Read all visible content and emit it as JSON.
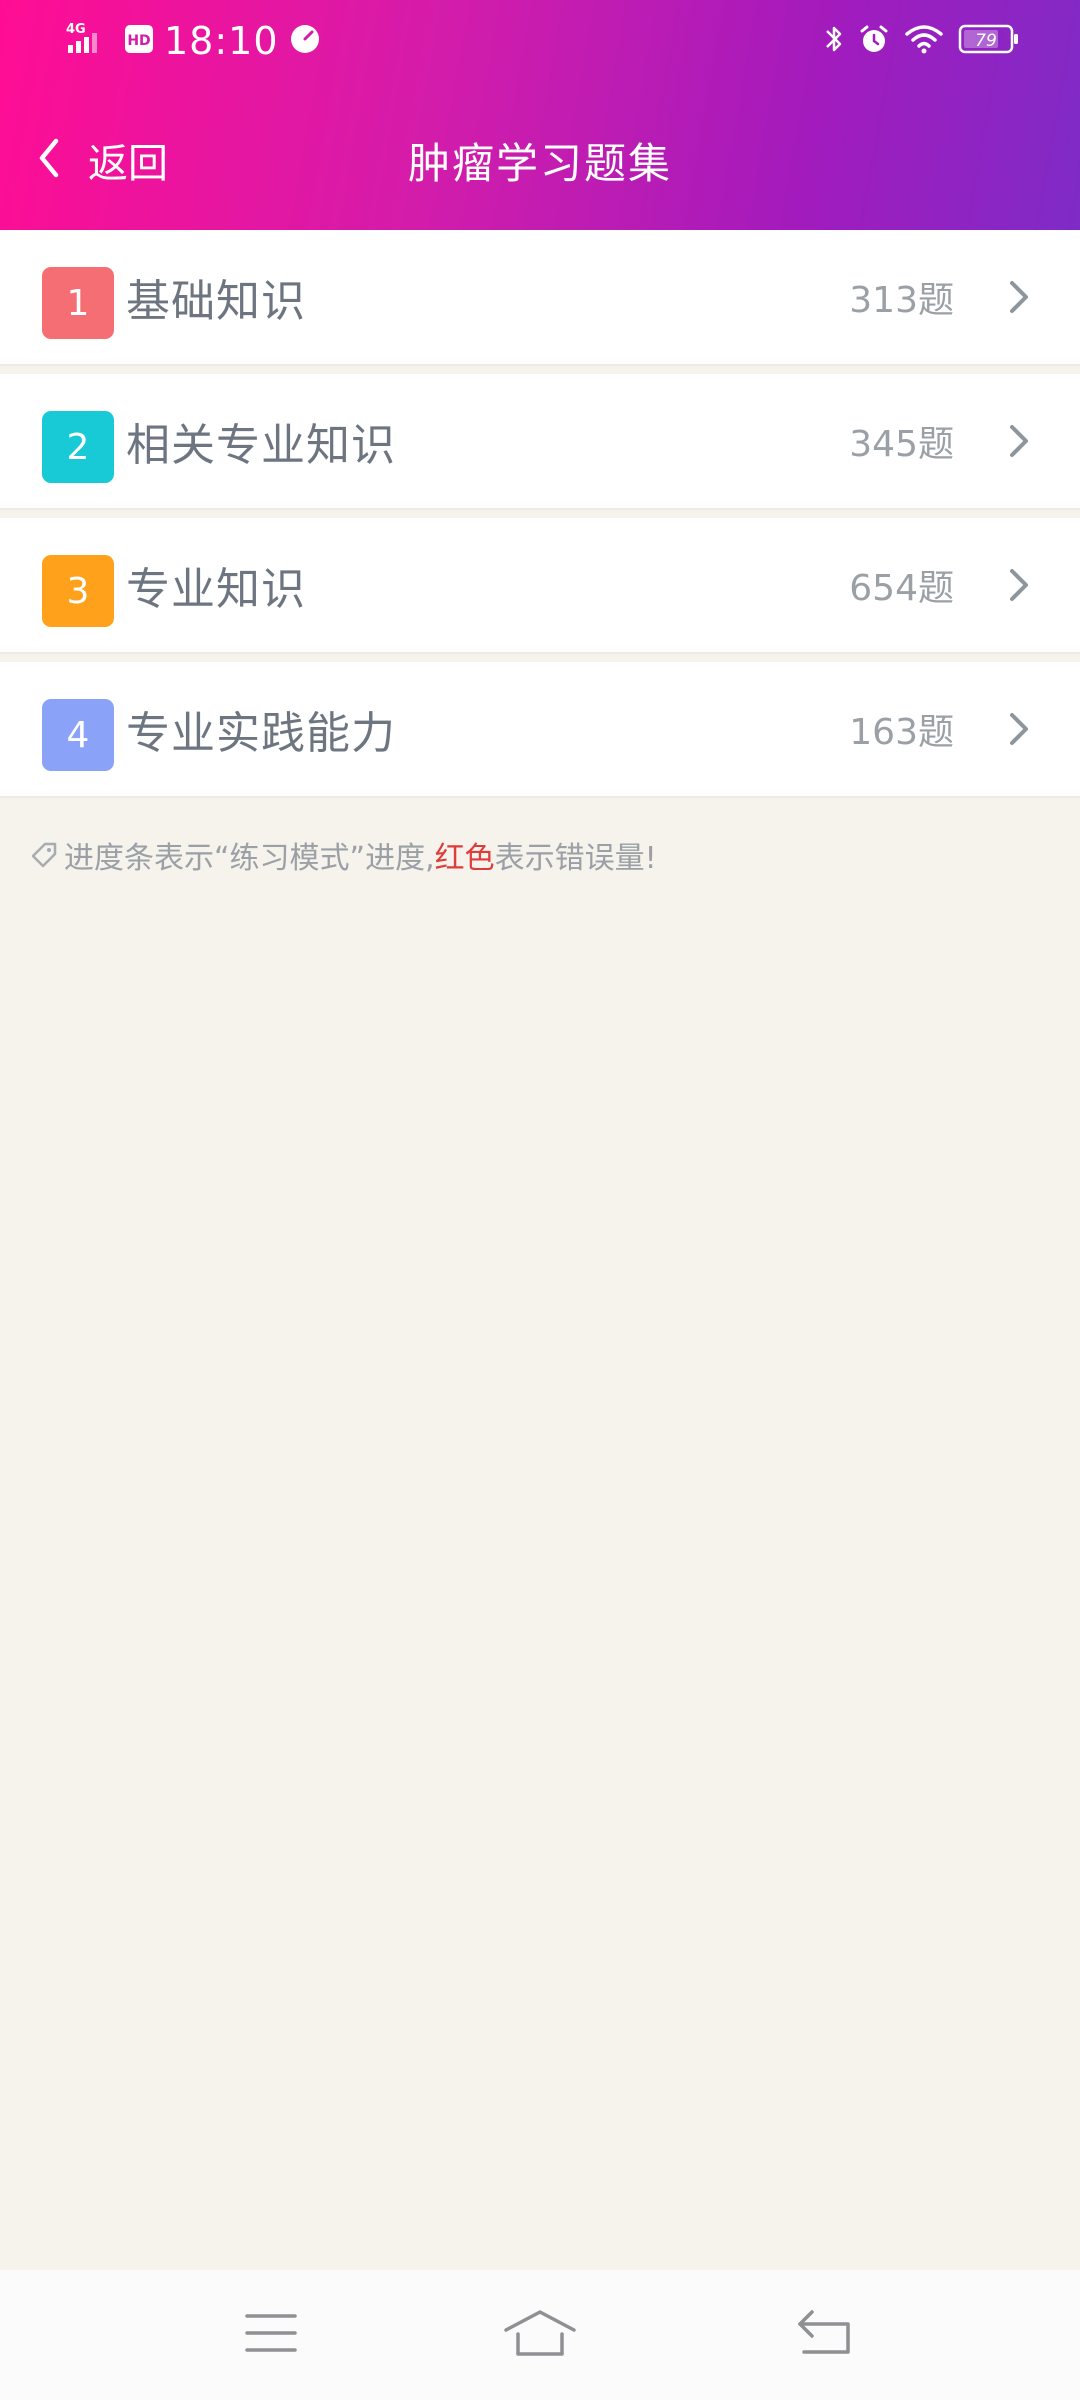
{
  "status_bar": {
    "network": "4G",
    "hd_label": "HD",
    "time": "18:10",
    "battery": "79"
  },
  "nav": {
    "back_label": "返回",
    "title": "肿瘤学习题集"
  },
  "items": [
    {
      "index": "1",
      "title": "基础知识",
      "count": "313题",
      "color": "#f56e73"
    },
    {
      "index": "2",
      "title": "相关专业知识",
      "count": "345题",
      "color": "#18c9d6"
    },
    {
      "index": "3",
      "title": "专业知识",
      "count": "654题",
      "color": "#ffa11a"
    },
    {
      "index": "4",
      "title": "专业实践能力",
      "count": "163题",
      "color": "#8aa2f7"
    }
  ],
  "note": {
    "prefix": "进度条表示“练习模式”进度,",
    "red": "红色",
    "suffix": "表示错误量!"
  },
  "icons": {
    "back": "chevron-left-icon",
    "chevron": "chevron-right-icon",
    "menu": "menu-icon",
    "home": "home-icon",
    "return": "return-icon"
  }
}
